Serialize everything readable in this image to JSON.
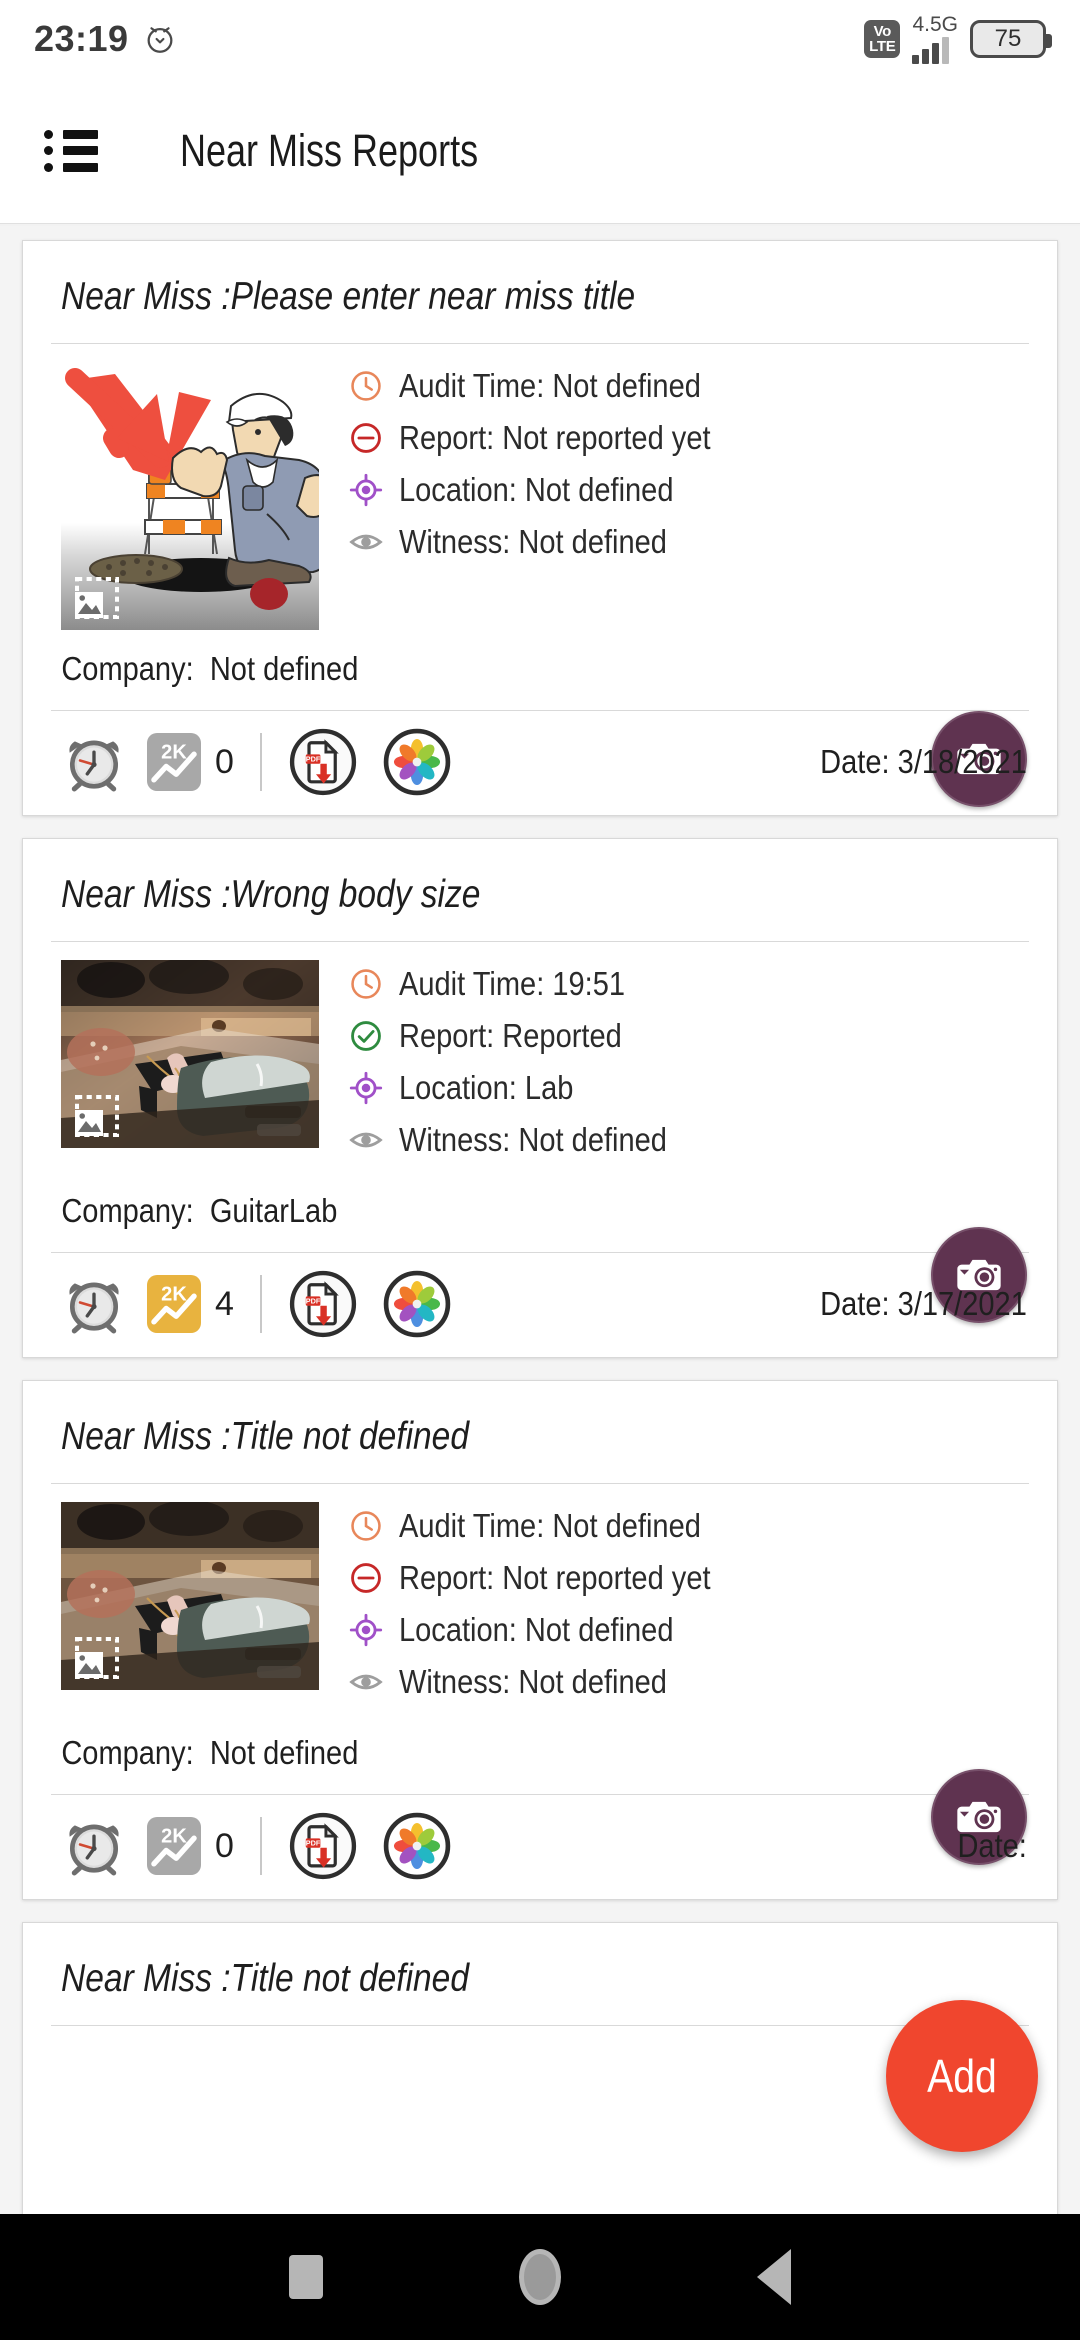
{
  "statusbar": {
    "time": "23:19",
    "alarm_icon": "alarm-clock-icon",
    "volte_top": "Vo",
    "volte_bottom": "LTE",
    "network": "4.5G",
    "battery": "75"
  },
  "appbar": {
    "menu_icon": "list-menu-icon",
    "title": "Near Miss Reports"
  },
  "labels": {
    "audit_time": "Audit Time:",
    "report": "Report:",
    "location": "Location:",
    "witness": "Witness:",
    "company": "Company:",
    "date": "Date:"
  },
  "colors": {
    "clock": "#E8875A",
    "report_pending": "#C62828",
    "report_done": "#2E8B3F",
    "location": "#A050C8",
    "witness": "#9E9E9E",
    "camera_fab": "#5F3350",
    "add_fab": "#F0462E",
    "badge_active": "#E8B33F",
    "badge_inactive": "#A8A8A8",
    "pdf_red": "#D93025"
  },
  "fab": {
    "label": "Add"
  },
  "cards": [
    {
      "title": "Near Miss :Please enter near miss title",
      "audit_time": "Not defined",
      "report": "Not reported yet",
      "report_status": "pending",
      "location": "Not defined",
      "witness": "Not defined",
      "company": "Not defined",
      "count": "0",
      "count_active": false,
      "date": "3/18/2021",
      "thumb": "cartoon-worker-manhole-barricade",
      "thumb_size": "tall"
    },
    {
      "title": "Near Miss :Wrong body size",
      "audit_time": "19:51",
      "report": "Reported",
      "report_status": "done",
      "location": "Lab",
      "witness": "Not defined",
      "company": "GuitarLab",
      "count": "4",
      "count_active": true,
      "date": "3/17/2021",
      "thumb": "workshop-power-tool-photo",
      "thumb_size": "short"
    },
    {
      "title": "Near Miss :Title not defined",
      "audit_time": "Not defined",
      "report": "Not reported yet",
      "report_status": "pending",
      "location": "Not defined",
      "witness": "Not defined",
      "company": "Not defined",
      "count": "0",
      "count_active": false,
      "date": "Date:",
      "thumb": "workshop-power-tool-photo",
      "thumb_size": "short"
    },
    {
      "title": "Near Miss :Title not defined"
    }
  ],
  "navbar": {
    "recents": "recents-square-icon",
    "home": "home-circle-icon",
    "back": "back-triangle-icon"
  }
}
